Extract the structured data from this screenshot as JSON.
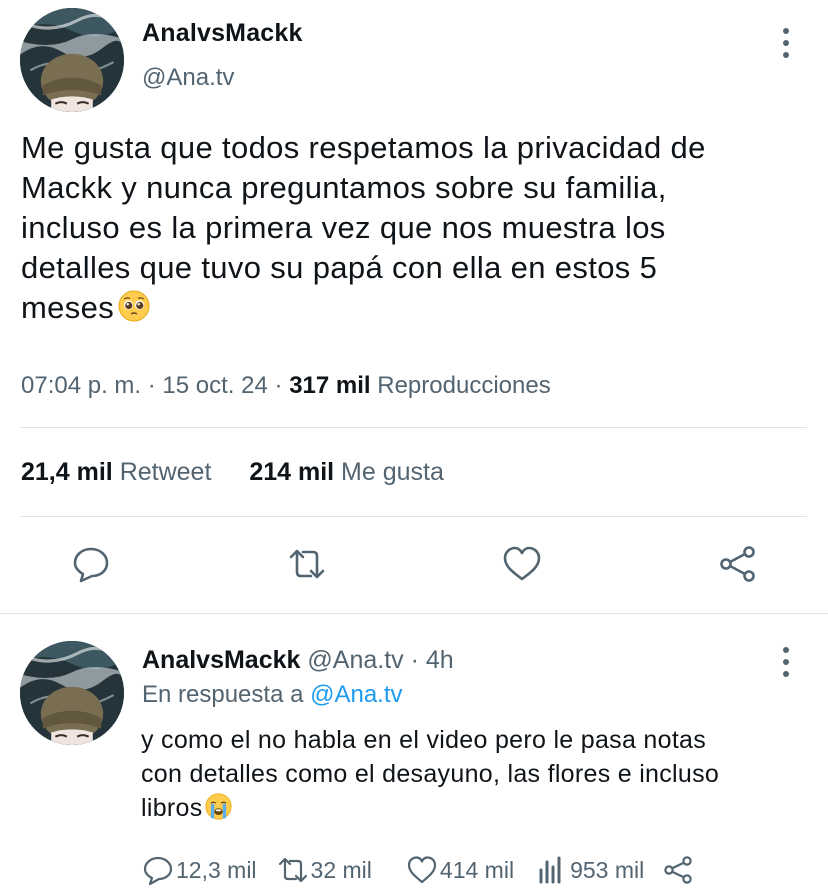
{
  "tweet": {
    "display_name": "AnalvsMackk",
    "handle": "@Ana.tv",
    "text_lines": [
      "Me gusta que todos respetamos la privacidad de",
      "Mackk y nunca preguntamos sobre su familia,",
      "incluso es la primera vez que nos muestra los",
      "detalles que tuvo su papá con ella en estos 5",
      "meses"
    ],
    "emoji": "pleading-face",
    "time": "07:04 p. m.",
    "date": "15 oct. 24",
    "views_count": "317 mil",
    "views_label": "Reproducciones",
    "retweets_count": "21,4 mil",
    "retweets_label": "Retweet",
    "likes_count": "214 mil",
    "likes_label": "Me gusta"
  },
  "reply": {
    "display_name": "AnalvsMackk",
    "handle": "@Ana.tv",
    "age": "4h",
    "in_reply_prefix": "En respuesta a",
    "in_reply_handle": "@Ana.tv",
    "text_lines": [
      "y como el no habla en el video pero le pasa notas",
      "con detalles como el desayuno, las flores e incluso",
      "libros"
    ],
    "emoji": "loudly-crying-face",
    "replies": "12,3 mil",
    "retweets": "32 mil",
    "likes": "414 mil",
    "views": "953 mil"
  },
  "colors": {
    "text": "#0f1419",
    "secondary": "#536471",
    "link": "#1d9bf0",
    "divider": "#dfe3e6"
  }
}
